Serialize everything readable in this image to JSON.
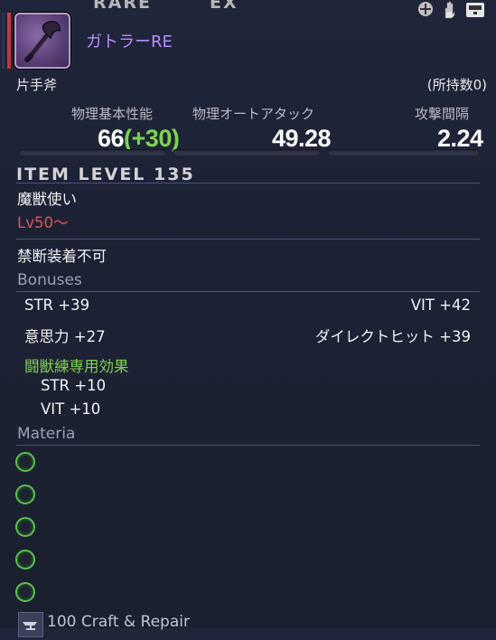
{
  "top": {
    "rare": "RARE",
    "ex": "EX"
  },
  "item": {
    "name": "ガトラーRE",
    "category": "片手斧",
    "owned": "(所持数0)"
  },
  "stats": {
    "headers": [
      "物理基本性能",
      "物理オートアタック",
      "攻撃間隔"
    ],
    "base_value": "66",
    "base_bonus": "(+30)",
    "auto_attack": "49.28",
    "delay": "2.24"
  },
  "item_level": "ITEM LEVEL 135",
  "job": "魔獣使い",
  "level_req": "Lv50〜",
  "restriction": "禁断装着不可",
  "bonuses": {
    "title": "Bonuses",
    "left": [
      "STR +39",
      "意思力 +27"
    ],
    "right": [
      "VIT +42",
      "ダイレクトヒット +39"
    ],
    "special_title": "闘獣練専用効果",
    "special": [
      "STR +10",
      "VIT +10"
    ]
  },
  "materia": {
    "title": "Materia",
    "slots": 5
  },
  "repair": {
    "text": "100 Craft & Repair"
  },
  "icons": {
    "item": "axe-icon",
    "controls": [
      "plus-icon",
      "hand-icon",
      "tray-icon"
    ]
  },
  "colors": {
    "name": "#b98cff",
    "bonus": "#7cd44b",
    "level": "#e15252",
    "materia": "#55c34a"
  }
}
